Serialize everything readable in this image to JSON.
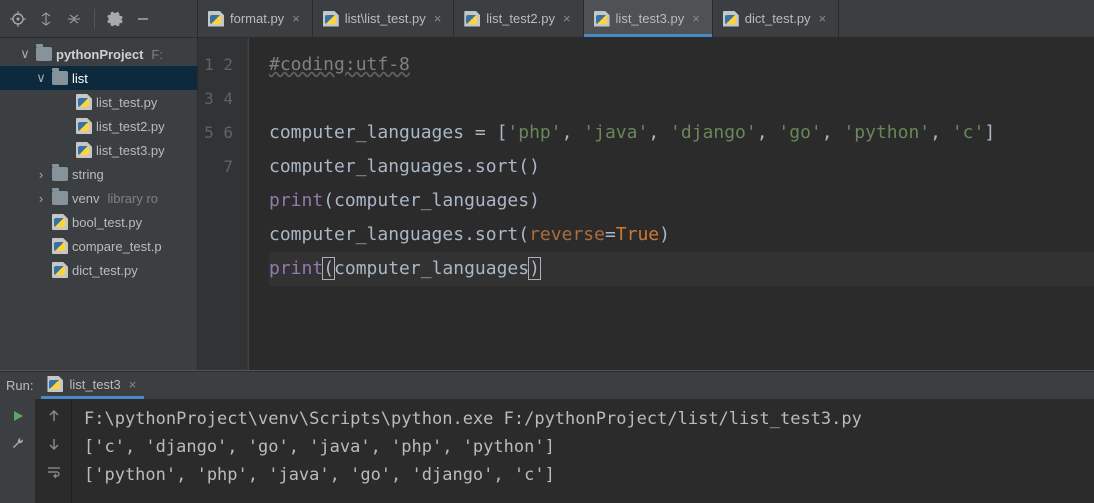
{
  "toolbar": {
    "icons": [
      "target-icon",
      "expand-icon",
      "collapse-icon",
      "gear-icon",
      "hide-icon"
    ]
  },
  "tabs": [
    {
      "label": "format.py",
      "active": false
    },
    {
      "label": "list\\list_test.py",
      "active": false
    },
    {
      "label": "list_test2.py",
      "active": false
    },
    {
      "label": "list_test3.py",
      "active": true
    },
    {
      "label": "dict_test.py",
      "active": false
    }
  ],
  "project": {
    "root": {
      "label": "pythonProject",
      "hint": "F:"
    },
    "list_folder": "list",
    "list_files": [
      "list_test.py",
      "list_test2.py",
      "list_test3.py"
    ],
    "string_folder": "string",
    "venv_folder": "venv",
    "venv_hint": "library ro",
    "root_files": [
      "bool_test.py",
      "compare_test.p",
      "dict_test.py"
    ]
  },
  "editor": {
    "line_numbers": [
      "1",
      "2",
      "3",
      "4",
      "5",
      "6",
      "7"
    ],
    "code_tokens": [
      [
        {
          "t": "#coding:utf-8",
          "c": "cm"
        }
      ],
      [
        {
          "t": "",
          "c": "id"
        }
      ],
      [
        {
          "t": "computer_languages = [",
          "c": "id"
        },
        {
          "t": "'php'",
          "c": "str"
        },
        {
          "t": ", ",
          "c": "id"
        },
        {
          "t": "'java'",
          "c": "str"
        },
        {
          "t": ", ",
          "c": "id"
        },
        {
          "t": "'django'",
          "c": "str"
        },
        {
          "t": ", ",
          "c": "id"
        },
        {
          "t": "'go'",
          "c": "str"
        },
        {
          "t": ", ",
          "c": "id"
        },
        {
          "t": "'python'",
          "c": "str"
        },
        {
          "t": ", ",
          "c": "id"
        },
        {
          "t": "'c'",
          "c": "str"
        },
        {
          "t": "]",
          "c": "id"
        }
      ],
      [
        {
          "t": "computer_languages.sort()",
          "c": "id"
        }
      ],
      [
        {
          "t": "print",
          "c": "kw"
        },
        {
          "t": "(computer_languages)",
          "c": "id"
        }
      ],
      [
        {
          "t": "computer_languages.sort(",
          "c": "id"
        },
        {
          "t": "reverse",
          "c": "arg"
        },
        {
          "t": "=",
          "c": "id"
        },
        {
          "t": "True",
          "c": "hl"
        },
        {
          "t": ")",
          "c": "id"
        }
      ],
      [
        {
          "t": "print",
          "c": "kw"
        },
        {
          "t": "(",
          "c": "id",
          "box": true
        },
        {
          "t": "computer_languages",
          "c": "id"
        },
        {
          "t": ")",
          "c": "id",
          "box": true
        }
      ]
    ],
    "caret_line": 7
  },
  "run": {
    "panel_label": "Run:",
    "tab_label": "list_test3",
    "output": [
      "F:\\pythonProject\\venv\\Scripts\\python.exe F:/pythonProject/list/list_test3.py",
      "['c', 'django', 'go', 'java', 'php', 'python']",
      "['python', 'php', 'java', 'go', 'django', 'c']"
    ]
  }
}
